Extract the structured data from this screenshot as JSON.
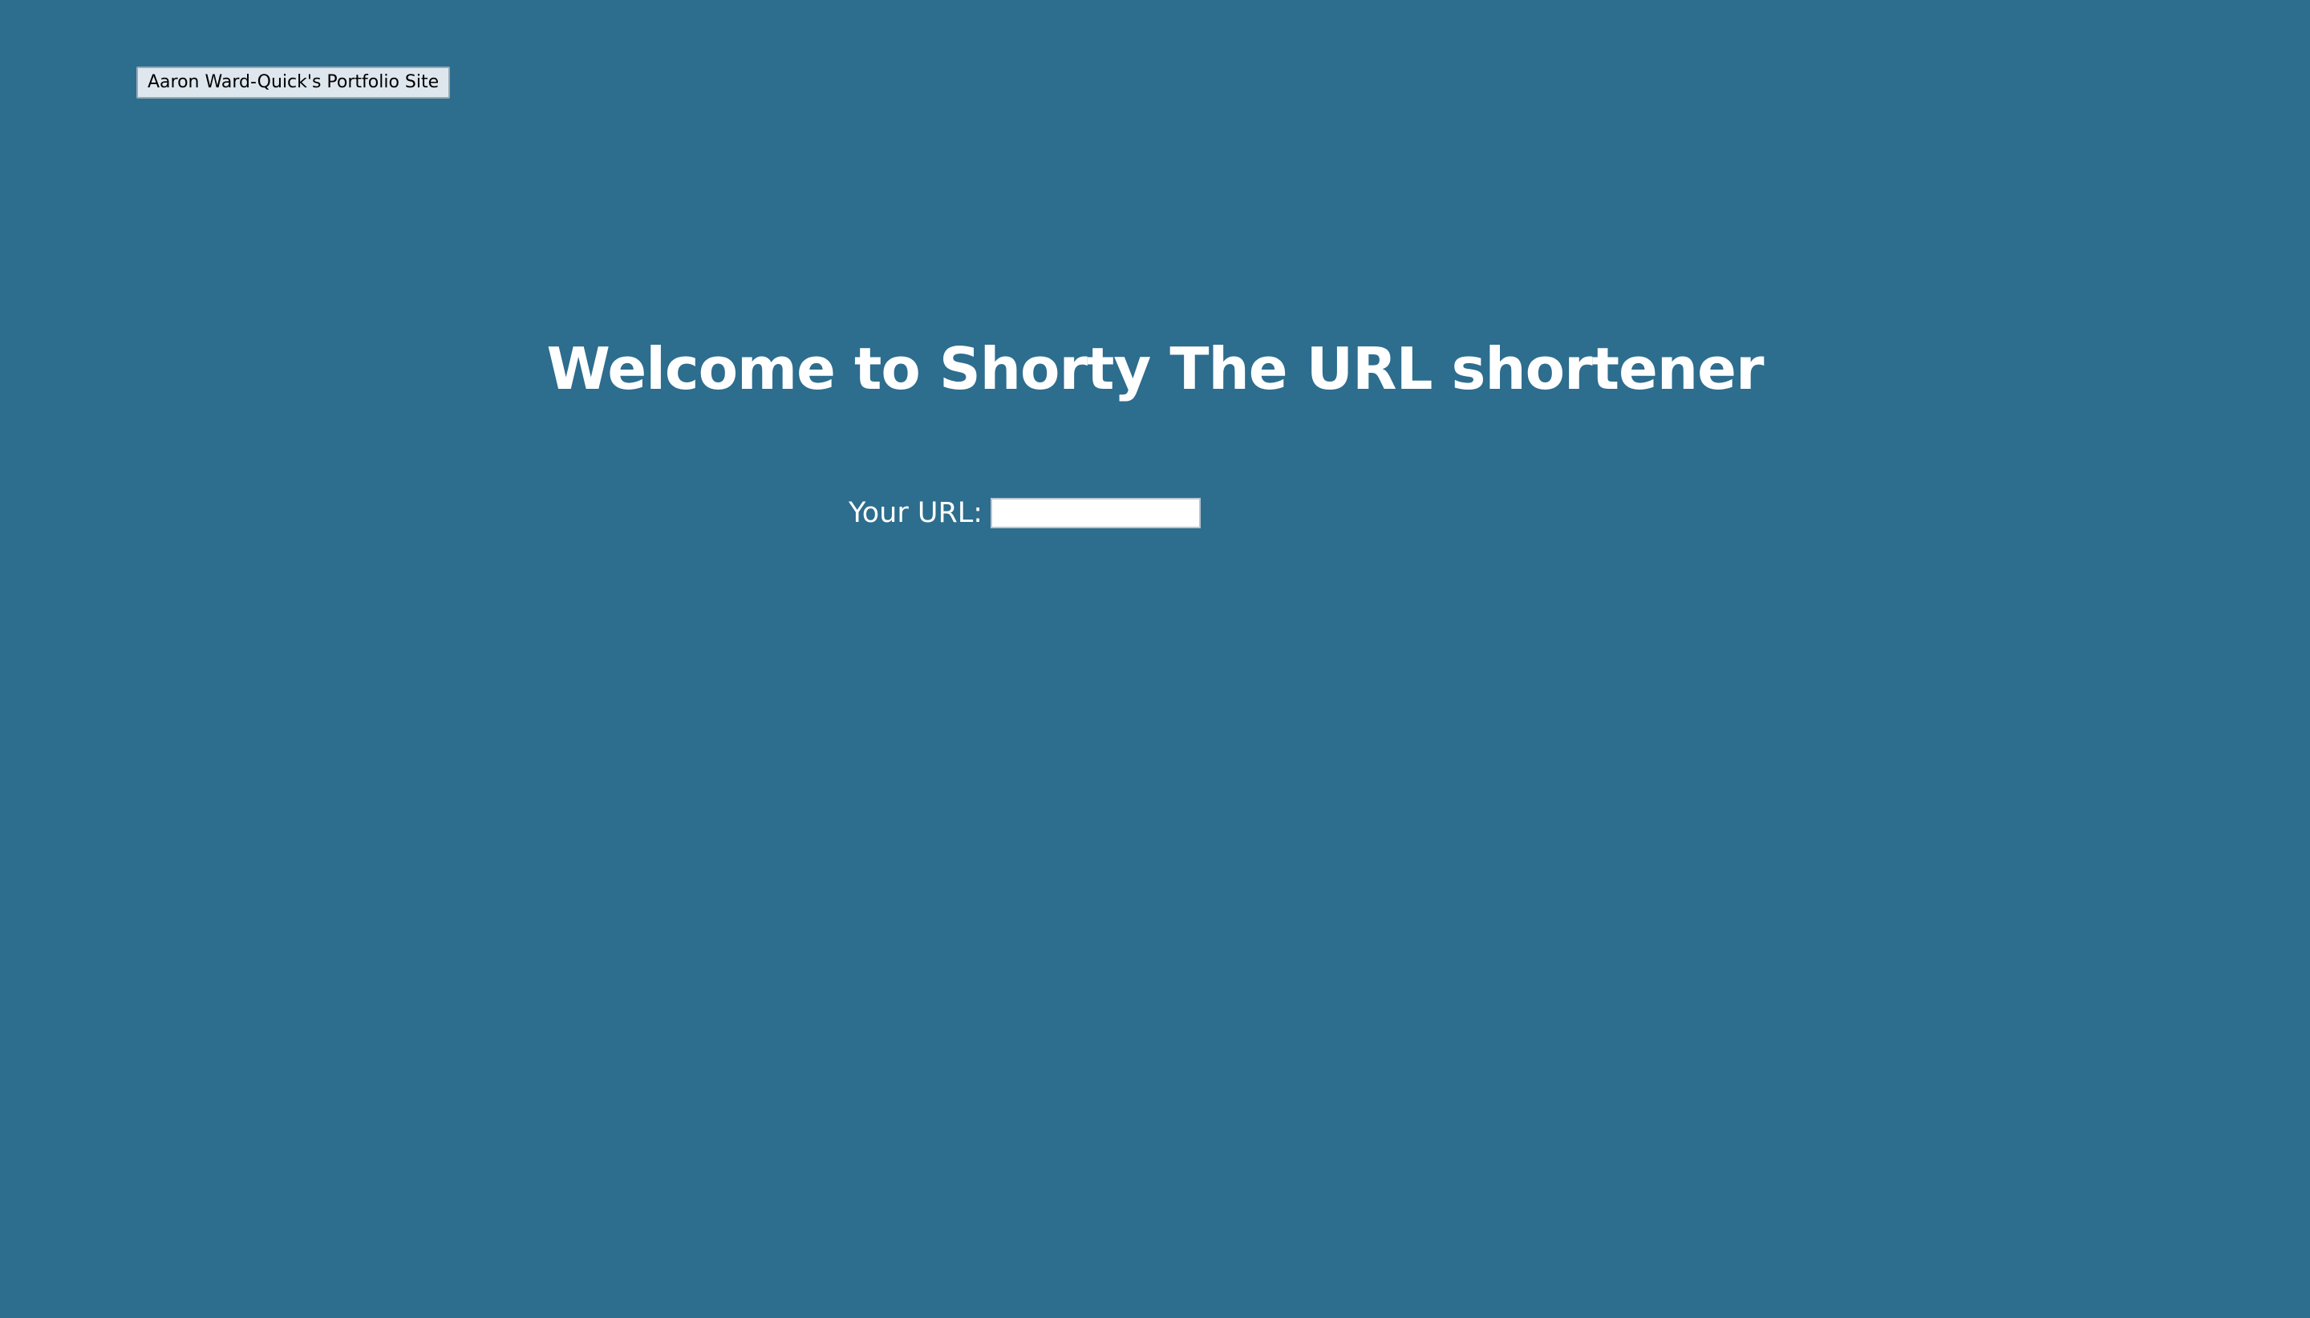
{
  "page": {
    "background_color": "#2d6d8e",
    "text_color": "#ffffff"
  },
  "header": {
    "portfolio_button_label": "Aaron Ward-Quick's Portfolio Site"
  },
  "main": {
    "title": "Welcome to Shorty The URL shortener",
    "url_label": "Your URL:",
    "url_value": "",
    "url_placeholder": ""
  }
}
